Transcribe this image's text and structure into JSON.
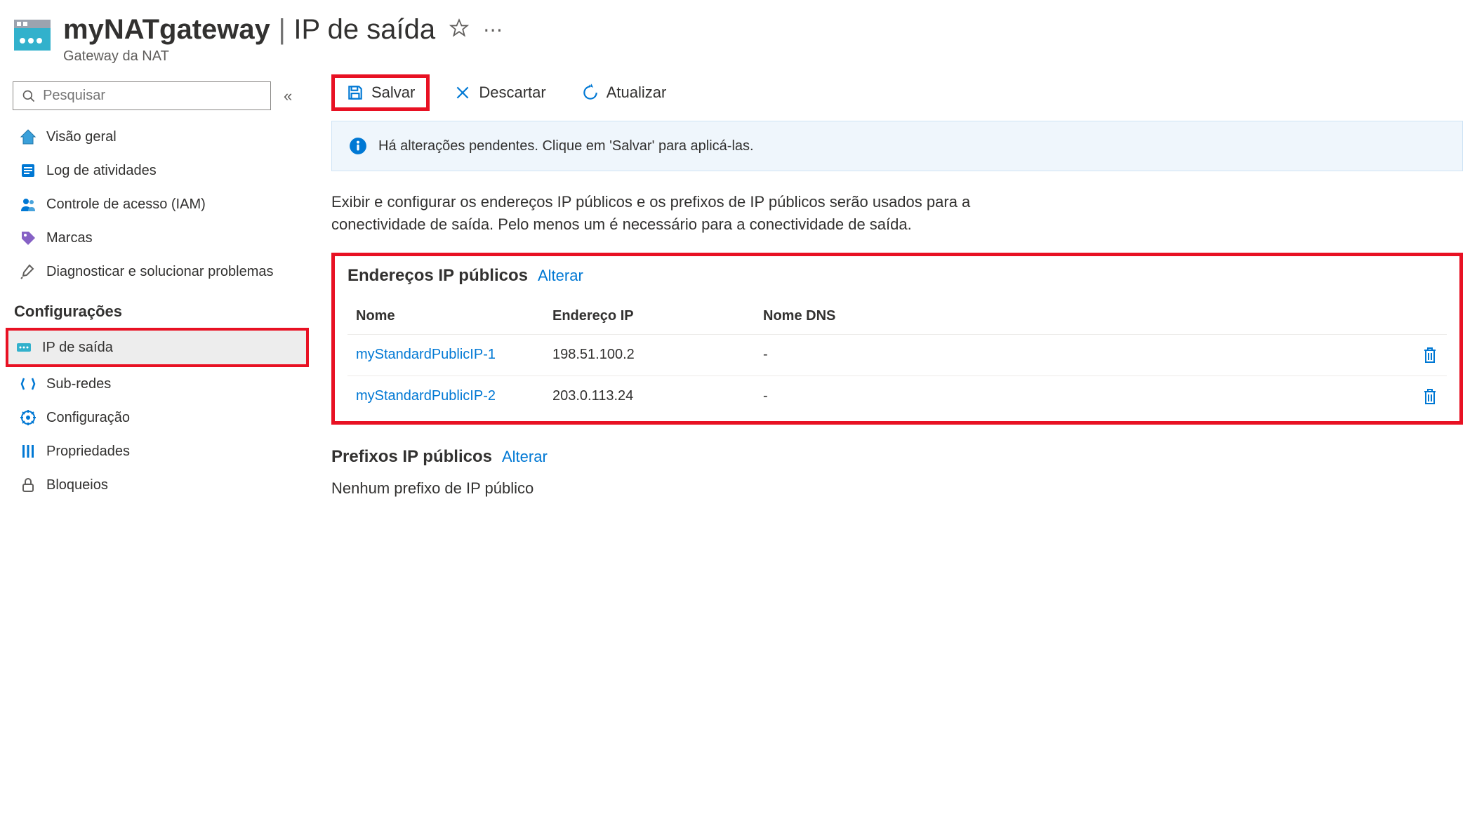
{
  "header": {
    "resource_name": "myNATgateway",
    "page_name": "IP de saída",
    "resource_type": "Gateway da NAT"
  },
  "search": {
    "placeholder": "Pesquisar"
  },
  "sidebar": {
    "items": [
      {
        "label": "Visão geral",
        "icon": "overview"
      },
      {
        "label": "Log de atividades",
        "icon": "activity-log"
      },
      {
        "label": "Controle de acesso (IAM)",
        "icon": "iam"
      },
      {
        "label": "Marcas",
        "icon": "tags"
      },
      {
        "label": "Diagnosticar e solucionar problemas",
        "icon": "diagnose"
      }
    ],
    "section_title": "Configurações",
    "config_items": [
      {
        "label": "IP de saída",
        "icon": "outbound-ip",
        "selected": true
      },
      {
        "label": "Sub-redes",
        "icon": "subnets"
      },
      {
        "label": "Configuração",
        "icon": "configuration"
      },
      {
        "label": "Propriedades",
        "icon": "properties"
      },
      {
        "label": "Bloqueios",
        "icon": "locks"
      }
    ]
  },
  "toolbar": {
    "save_label": "Salvar",
    "discard_label": "Descartar",
    "refresh_label": "Atualizar"
  },
  "info_banner": {
    "text": "Há alterações pendentes. Clique em 'Salvar' para aplicá-las."
  },
  "description": "Exibir e configurar os endereços IP públicos e os prefixos de IP públicos serão usados para a conectividade de saída. Pelo menos um é necessário para a conectividade de saída.",
  "public_ips": {
    "title": "Endereços IP públicos",
    "change_label": "Alterar",
    "headers": {
      "name": "Nome",
      "ip": "Endereço IP",
      "dns": "Nome DNS"
    },
    "rows": [
      {
        "name": "myStandardPublicIP-1",
        "ip": "198.51.100.2",
        "dns": "-"
      },
      {
        "name": "myStandardPublicIP-2",
        "ip": "203.0.113.24",
        "dns": "-"
      }
    ]
  },
  "prefixes": {
    "title": "Prefixos IP públicos",
    "change_label": "Alterar",
    "empty_text": "Nenhum prefixo de IP público"
  }
}
